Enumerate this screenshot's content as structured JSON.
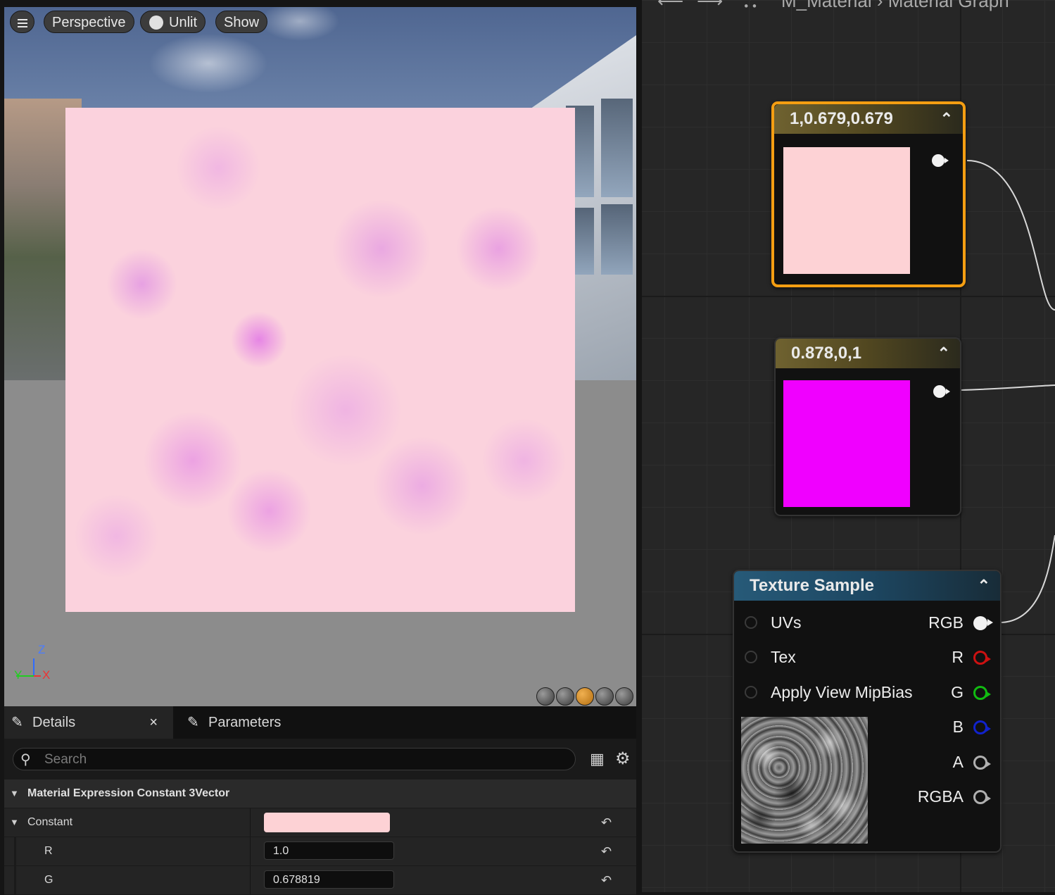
{
  "viewport": {
    "menu_icon": "hamburger-icon",
    "perspective_label": "Perspective",
    "unlit_label": "Unlit",
    "show_label": "Show",
    "axis": {
      "z": "Z",
      "y": "Y",
      "x": "X"
    },
    "preview_shapes": [
      "cylinder",
      "sphere",
      "plane",
      "cube",
      "custom-mesh"
    ],
    "colors": {
      "plane_base": "#fbd2dd",
      "plane_spots": "#e078e6"
    }
  },
  "details": {
    "tab_details": "Details",
    "tab_close": "×",
    "tab_parameters": "Parameters",
    "search_placeholder": "Search",
    "section_title": "Material Expression Constant 3Vector",
    "constant_label": "Constant",
    "constant_color": "#fdd2d5",
    "r_label": "R",
    "r_value": "1.0",
    "g_label": "G",
    "g_value": "0.678819"
  },
  "graph": {
    "header": "M_Material  ›  Material Graph",
    "node1": {
      "title": "1,0.679,0.679",
      "color": "#fdd2d5"
    },
    "node2": {
      "title": "0.878,0,1",
      "color": "#f000ff"
    },
    "texture_node": {
      "title": "Texture Sample",
      "inputs": [
        "UVs",
        "Tex",
        "Apply View MipBias"
      ],
      "outputs": [
        {
          "label": "RGB",
          "color": "#f2f2f2"
        },
        {
          "label": "R",
          "color": "#cc1111"
        },
        {
          "label": "G",
          "color": "#11bb11"
        },
        {
          "label": "B",
          "color": "#1122cc"
        },
        {
          "label": "A",
          "color": "#b0b0b0"
        },
        {
          "label": "RGBA",
          "color": "#b0b0b0"
        }
      ]
    },
    "accent_selected": "#f49e12"
  }
}
